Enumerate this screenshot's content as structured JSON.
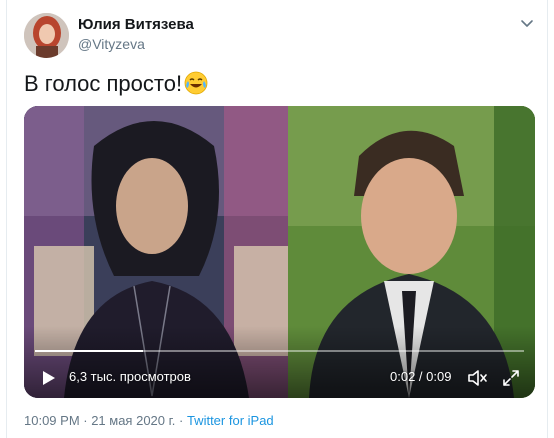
{
  "author": {
    "name": "Юлия Витязева",
    "handle": "@Vityzeva"
  },
  "tweet": {
    "text": "В голос просто!",
    "emoji": "face-with-tears-of-joy"
  },
  "video": {
    "views": "6,3 тыс. просмотров",
    "time": "0:02 / 0:09",
    "progress": 0.22
  },
  "meta": {
    "timestamp": "10:09 PM · 21 мая 2020 г. · ",
    "source": "Twitter for iPad"
  },
  "colors": {
    "link": "#1b95e0",
    "secondary": "#657786",
    "text": "#14171a"
  }
}
